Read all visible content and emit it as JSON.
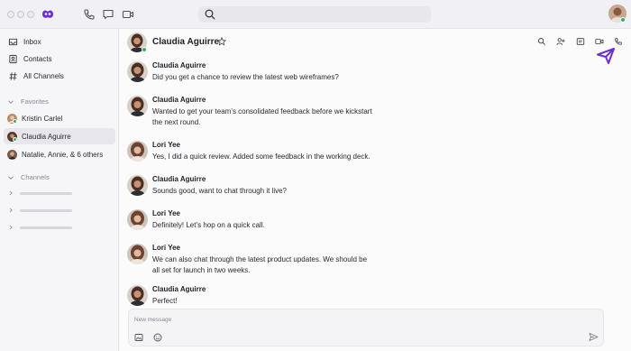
{
  "search": {
    "placeholder": ""
  },
  "sidebar": {
    "nav": [
      {
        "label": "Inbox",
        "icon": "inbox-icon"
      },
      {
        "label": "Contacts",
        "icon": "contacts-icon"
      },
      {
        "label": "All Channels",
        "icon": "hash-icon"
      }
    ],
    "favorites_title": "Favorites",
    "favorites": [
      {
        "label": "Kristin Carlel"
      },
      {
        "label": "Claudia Aguirre"
      },
      {
        "label": "Natalie, Annie, & 6 others"
      }
    ],
    "channels_title": "Channels"
  },
  "conversation": {
    "title": "Claudia Aguirre"
  },
  "messages": [
    {
      "name": "Claudia Aguirre",
      "text": "Did you get a chance to review the latest web wireframes?"
    },
    {
      "name": "Claudia Aguirre",
      "text": "Wanted to get your team’s consolidated feedback before we kickstart the next round."
    },
    {
      "name": "Lori Yee",
      "text": "Yes, I did a quick review. Added some feedback in the working deck."
    },
    {
      "name": "Claudia Aguirre",
      "text": "Sounds good, want to chat through it live?"
    },
    {
      "name": "Lori Yee",
      "text": "Definitely! Let’s hop on a quick call."
    },
    {
      "name": "Lori Yee",
      "text": "We can also chat through the latest product updates. We should be all set for launch in two weeks."
    },
    {
      "name": "Claudia Aguirre",
      "text": "Perfect!"
    }
  ],
  "composer": {
    "placeholder": "New message"
  },
  "colors": {
    "accent": "#6b2fd6",
    "presence": "#2fb65a"
  }
}
